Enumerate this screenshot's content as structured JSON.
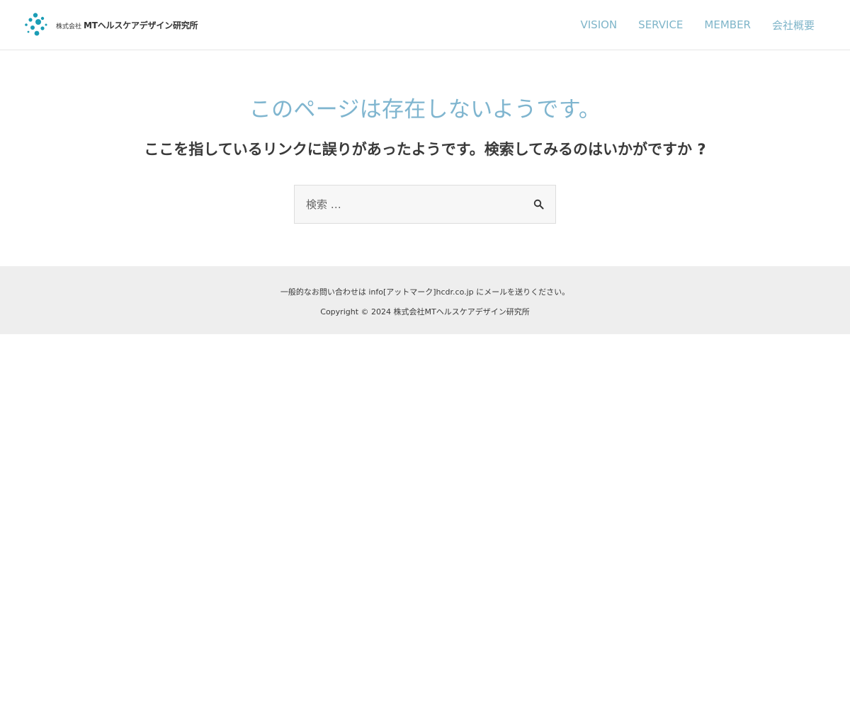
{
  "header": {
    "logo": {
      "company_prefix": "株式会社",
      "company_name": "MTヘルスケアデザイン研究所",
      "brand_color": "#1b9db5"
    },
    "nav": [
      {
        "label": "VISION"
      },
      {
        "label": "SERVICE"
      },
      {
        "label": "MEMBER"
      },
      {
        "label": "会社概要"
      }
    ],
    "nav_color": "#7fb5c9"
  },
  "main": {
    "title": "このページは存在しないようです。",
    "message": "ここを指しているリンクに誤りがあったようです。検索してみるのはいかがですか ?",
    "search": {
      "placeholder": "検索 …",
      "value": "",
      "icon": "search-icon"
    }
  },
  "footer": {
    "contact": "一般的なお問い合わせは info[アットマーク]hcdr.co.jp にメールを送りください。",
    "copyright": "Copyright © 2024 株式会社MTヘルスケアデザイン研究所"
  }
}
